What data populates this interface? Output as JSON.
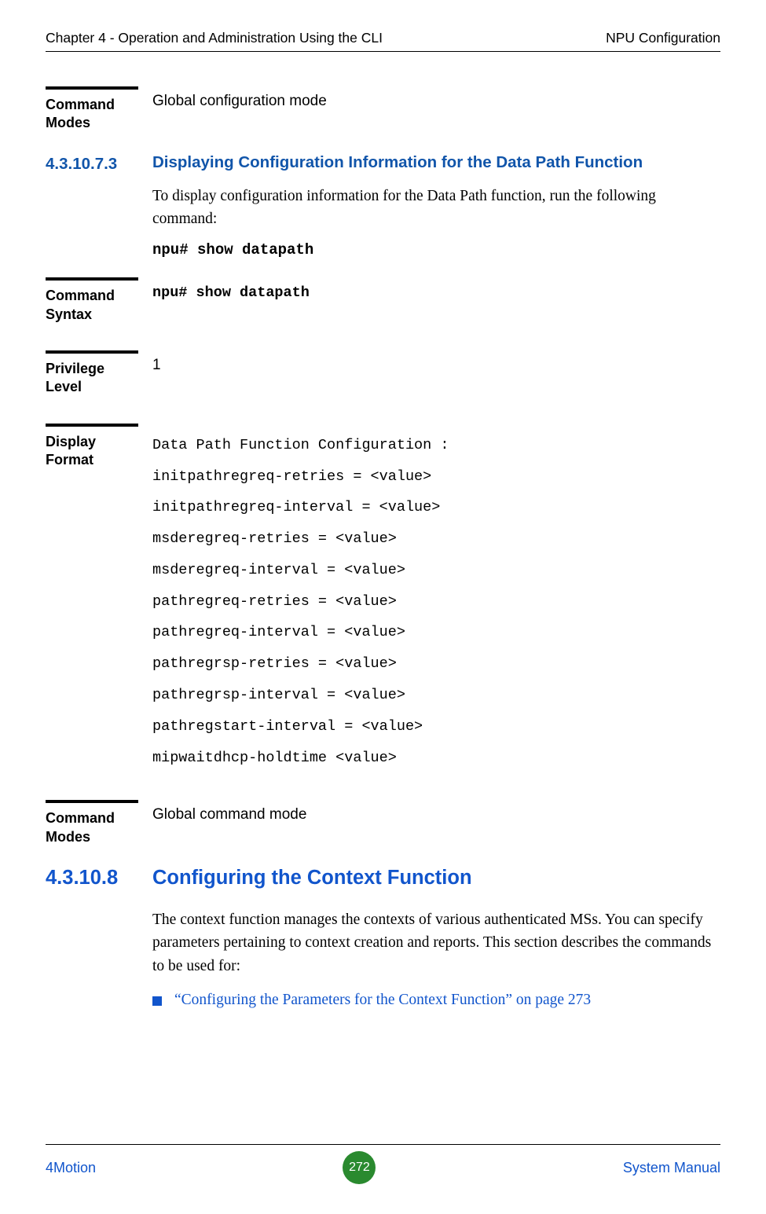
{
  "header": {
    "left": "Chapter 4 - Operation and Administration Using the CLI",
    "right": "NPU Configuration"
  },
  "block_cmd_modes_top": {
    "label_line1": "Command",
    "label_line2": "Modes",
    "value": "Global configuration mode"
  },
  "sec_43_10_7_3": {
    "num": "4.3.10.7.3",
    "title": "Displaying Configuration Information for the Data Path Function",
    "para": "To display configuration information for the Data Path function, run the following command:",
    "cmd": "npu# show datapath"
  },
  "block_cmd_syntax": {
    "label_line1": "Command",
    "label_line2": "Syntax",
    "value": "npu# show datapath"
  },
  "block_priv": {
    "label_line1": "Privilege",
    "label_line2": "Level",
    "value": "1"
  },
  "block_display": {
    "label_line1": "Display",
    "label_line2": "Format",
    "lines": [
      "Data Path Function Configuration :",
      "initpathregreq-retries = <value>",
      "initpathregreq-interval = <value>",
      "msderegreq-retries = <value>",
      "msderegreq-interval = <value>",
      "pathregreq-retries = <value>",
      "pathregreq-interval = <value>",
      "pathregrsp-retries = <value>",
      "pathregrsp-interval = <value>",
      "pathregstart-interval = <value>",
      "mipwaitdhcp-holdtime <value>"
    ]
  },
  "block_cmd_modes_bottom": {
    "label_line1": "Command",
    "label_line2": "Modes",
    "value": "Global command mode"
  },
  "sec_43_10_8": {
    "num": "4.3.10.8",
    "title": "Configuring the Context Function",
    "para": "The context function manages the contexts of various authenticated MSs. You can specify parameters pertaining to context creation and reports. This section describes the commands to be used for:",
    "bullet": "“Configuring the Parameters for the Context Function” on page 273"
  },
  "footer": {
    "left": "4Motion",
    "page": "272",
    "right": "System Manual"
  }
}
